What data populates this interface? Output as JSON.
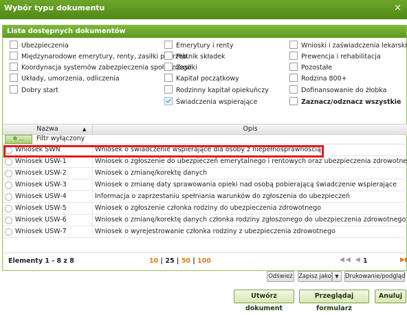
{
  "window": {
    "title": "Wybór typu dokumentu",
    "close_glyph": "×"
  },
  "panel": {
    "title": "Lista dostępnych dokumentów"
  },
  "checkboxes": {
    "col1": [
      {
        "label": "Ubezpieczenia",
        "checked": false
      },
      {
        "label": "Międzynarodowe emerytury, renty, zasiłki pogrzeb.",
        "checked": false
      },
      {
        "label": "Koordynacja systemów zabezpieczenia społecznego",
        "checked": false
      },
      {
        "label": "Układy, umorzenia, odliczenia",
        "checked": false
      },
      {
        "label": "Dobry start",
        "checked": false
      }
    ],
    "col2": [
      {
        "label": "Emerytury i renty",
        "checked": false
      },
      {
        "label": "Płatnik składek",
        "checked": false
      },
      {
        "label": "Zasiłki",
        "checked": false
      },
      {
        "label": "Kapitał początkowy",
        "checked": false
      },
      {
        "label": "Rodzinny kapitał opiekuńczy",
        "checked": false
      },
      {
        "label": "Świadczenia wspierające",
        "checked": true
      }
    ],
    "col3": [
      {
        "label": "Wnioski i zaświadczenia lekarskie",
        "checked": false
      },
      {
        "label": "Prewencja i rehabilitacja",
        "checked": false
      },
      {
        "label": "Pozostałe",
        "checked": false
      },
      {
        "label": "Rodzina 800+",
        "checked": false
      },
      {
        "label": "Dofinansowanie do żłobka",
        "checked": false
      },
      {
        "label": "Zaznacz/odznacz wszystkie",
        "checked": false
      }
    ]
  },
  "grid": {
    "col_nazwa": "Nazwa",
    "col_opis": "Opis",
    "sort_glyph": "▲",
    "filter_button": "...",
    "filter_label": "Filtr wyłączony",
    "rows": [
      {
        "nazwa": "Wniosek SWN",
        "opis": "Wniosek o świadczenie wspierające dla osoby z niepełnosprawnością"
      },
      {
        "nazwa": "Wniosek USW-1",
        "opis": "Wniosek o zgłoszenie do ubezpieczeń emerytalnego i rentowych oraz ubezpieczenia zdrowotnego"
      },
      {
        "nazwa": "Wniosek USW-2",
        "opis": "Wniosek o zmianę/korektę danych"
      },
      {
        "nazwa": "Wniosek USW-3",
        "opis": "Wniosek o zmianę daty sprawowania opieki nad osobą pobierającą świadczenie wspierające"
      },
      {
        "nazwa": "Wniosek USW-4",
        "opis": "Informacja o zaprzestaniu spełniania warunków do zgłoszenia do ubezpieczeń"
      },
      {
        "nazwa": "Wniosek USW-5",
        "opis": "Wniosek o zgłoszenie członka rodziny do ubezpieczenia zdrowotnego"
      },
      {
        "nazwa": "Wniosek USW-6",
        "opis": "Wniosek o zmianę/korektę danych członka rodziny zgłoszonego do ubezpieczenia zdrowotnego"
      },
      {
        "nazwa": "Wniosek USW-7",
        "opis": "Wniosek o wyrejestrowanie członka rodziny z ubezpieczenia zdrowotnego"
      }
    ]
  },
  "pager": {
    "elements": "Elementy 1 - 8 z 8",
    "size_10": "10",
    "size_25": "25",
    "size_50": "50",
    "size_100": "100",
    "size_sep": "|",
    "nav_first_prev": "◀◀ ◀",
    "page": "1",
    "nav_last": "▶▶"
  },
  "toolbar": {
    "refresh": "Odśwież",
    "save_as": "Zapisz jako",
    "dropdown_glyph": "▼",
    "print": "Drukowanie/podgląd"
  },
  "footer": {
    "create": "Utwórz dokument",
    "browse": "Przeglądaj formularz",
    "cancel": "Anuluj"
  }
}
